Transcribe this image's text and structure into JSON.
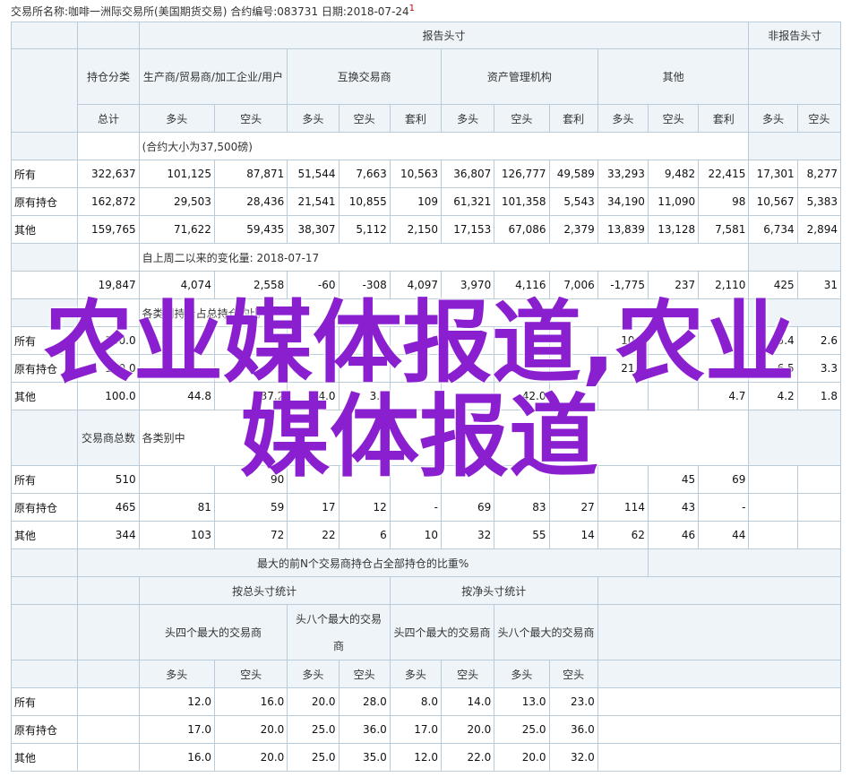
{
  "header": {
    "text": "交易所名称:咖啡一洲际交易所(美国期货交易)   合约编号:083731   日期:2018-07-24",
    "mark": "1"
  },
  "cols": {
    "reportable": "报告头寸",
    "nonreportable": "非报告头寸",
    "category": "持仓分类",
    "producer": "生产商/贸易商/加工企业/用户",
    "swap": "互换交易商",
    "managed": "资产管理机构",
    "other": "其他",
    "total": "总计",
    "long": "多头",
    "short": "空头",
    "spread": "套利"
  },
  "sec1": {
    "note": "(合约大小为37,500磅)",
    "rows": [
      {
        "label": "所有",
        "v": [
          "322,637",
          "101,125",
          "87,871",
          "51,544",
          "7,663",
          "10,563",
          "36,807",
          "126,777",
          "49,589",
          "33,293",
          "9,482",
          "22,415",
          "17,301",
          "8,277"
        ]
      },
      {
        "label": "原有持仓",
        "v": [
          "162,872",
          "29,503",
          "28,436",
          "21,541",
          "10,855",
          "109",
          "61,321",
          "101,358",
          "5,543",
          "34,190",
          "11,090",
          "98",
          "10,567",
          "5,383"
        ]
      },
      {
        "label": "其他",
        "v": [
          "159,765",
          "71,622",
          "59,435",
          "38,307",
          "5,112",
          "2,150",
          "17,153",
          "67,086",
          "2,379",
          "13,839",
          "13,128",
          "7,581",
          "6,734",
          "2,894"
        ]
      }
    ]
  },
  "sec2": {
    "note": "自上周二以来的变化量: 2018-07-17",
    "row": [
      "19,847",
      "4,074",
      "2,558",
      "-60",
      "-308",
      "4,097",
      "3,970",
      "4,116",
      "7,006",
      "-1,775",
      "237",
      "2,110",
      "425",
      "31"
    ]
  },
  "sec3": {
    "note": "各类别持仓占总持仓的比",
    "rows": [
      {
        "label": "所有",
        "v": [
          "100.0",
          "",
          "",
          "",
          "",
          "3.3",
          "",
          "",
          "",
          "10.3",
          "",
          "",
          "5.4",
          "2.6"
        ]
      },
      {
        "label": "原有持仓",
        "v": [
          "100.0",
          "",
          "",
          "",
          "",
          "",
          "",
          "",
          "",
          "21.0",
          "",
          "",
          "6.5",
          "3.3"
        ]
      },
      {
        "label": "其他",
        "v": [
          "100.0",
          "44.8",
          "37.2",
          "24.0",
          "3.2",
          "",
          "",
          "42.0",
          "",
          "",
          "",
          "4.7",
          "4.2",
          "1.8"
        ]
      }
    ]
  },
  "sec4": {
    "label": "交易商总数",
    "note": "各类别中",
    "rows": [
      {
        "label": "所有",
        "v": [
          "510",
          "",
          "90",
          "",
          "",
          "",
          "",
          "",
          "",
          "",
          "45",
          "69",
          "",
          ""
        ]
      },
      {
        "label": "原有持仓",
        "v": [
          "465",
          "81",
          "59",
          "17",
          "12",
          "-",
          "69",
          "83",
          "27",
          "114",
          "43",
          "-",
          "",
          ""
        ]
      },
      {
        "label": "其他",
        "v": [
          "344",
          "103",
          "72",
          "22",
          "6",
          "10",
          "32",
          "55",
          "14",
          "62",
          "46",
          "44",
          "",
          ""
        ]
      }
    ]
  },
  "sec5": {
    "title": "最大的前N个交易商持仓占全部持仓的比重%",
    "gross": "按总头寸统计",
    "net": "按净头寸统计",
    "top4": "头四个最大的交易商",
    "top8": "头八个最大的交易商",
    "rows": [
      {
        "label": "所有",
        "v": [
          "12.0",
          "16.0",
          "20.0",
          "28.0",
          "8.0",
          "14.0",
          "13.0",
          "23.0"
        ]
      },
      {
        "label": "原有持仓",
        "v": [
          "17.0",
          "20.0",
          "25.0",
          "36.0",
          "17.0",
          "20.0",
          "25.0",
          "36.0"
        ]
      },
      {
        "label": "其他",
        "v": [
          "16.0",
          "20.0",
          "25.0",
          "35.0",
          "12.0",
          "22.0",
          "20.0",
          "32.0"
        ]
      }
    ]
  },
  "watermark": "农业媒体报道,农业媒体报道"
}
